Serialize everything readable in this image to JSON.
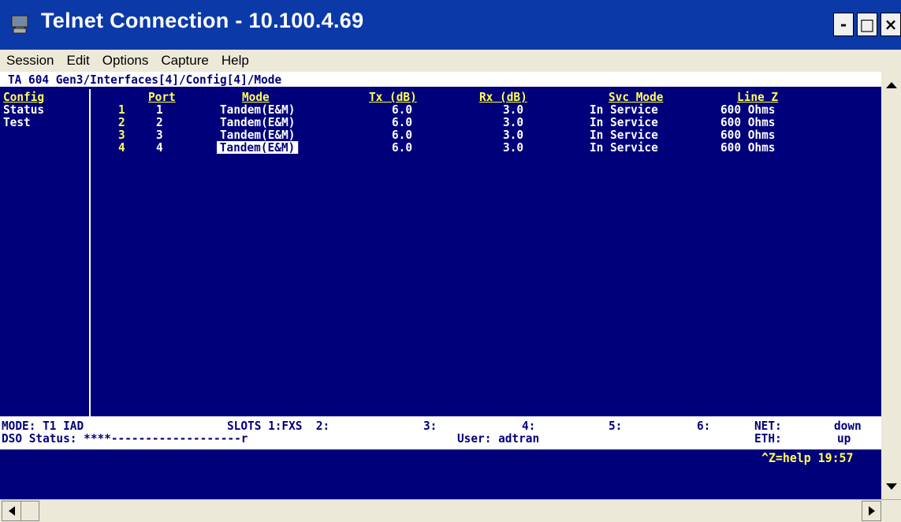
{
  "window": {
    "title": "Telnet Connection - 10.100.4.69",
    "buttons": [
      "-",
      "□",
      "×"
    ]
  },
  "menu": [
    "Session",
    "Edit",
    "Options",
    "Capture",
    "Help"
  ],
  "terminal": {
    "path": "TA 604 Gen3/Interfaces[4]/Config[4]/Mode",
    "sidebar": [
      "Config",
      "Status",
      "Test"
    ],
    "columns": [
      "Port",
      "Mode",
      "Tx (dB)",
      "Rx (dB)",
      "Svc Mode",
      "Line Z"
    ],
    "rows": [
      {
        "index": "1",
        "port": "1",
        "mode": "Tandem(E&M)",
        "tx": "6.0",
        "rx": "3.0",
        "svc": "In Service",
        "linez": "600 Ohms"
      },
      {
        "index": "2",
        "port": "2",
        "mode": "Tandem(E&M)",
        "tx": "6.0",
        "rx": "3.0",
        "svc": "In Service",
        "linez": "600 Ohms"
      },
      {
        "index": "3",
        "port": "3",
        "mode": "Tandem(E&M)",
        "tx": "6.0",
        "rx": "3.0",
        "svc": "In Service",
        "linez": "600 Ohms"
      },
      {
        "index": "4",
        "port": "4",
        "mode": "Tandem(E&M)",
        "tx": "6.0",
        "rx": "3.0",
        "svc": "In Service",
        "linez": "600 Ohms"
      }
    ],
    "status_line1": {
      "mode": "MODE: T1 IAD",
      "slots": "SLOTS 1:FXS  2:",
      "slot3": "3:",
      "slot4": "4:",
      "slot5": "5:",
      "slot6": "6:",
      "net_label": "NET:",
      "net_value": "down"
    },
    "status_line2": {
      "ds0": "DSO Status: ****-------------------r",
      "user": "User: adtran",
      "eth_label": "ETH:",
      "eth_value": "up"
    },
    "help": "^Z=help 19:57"
  }
}
